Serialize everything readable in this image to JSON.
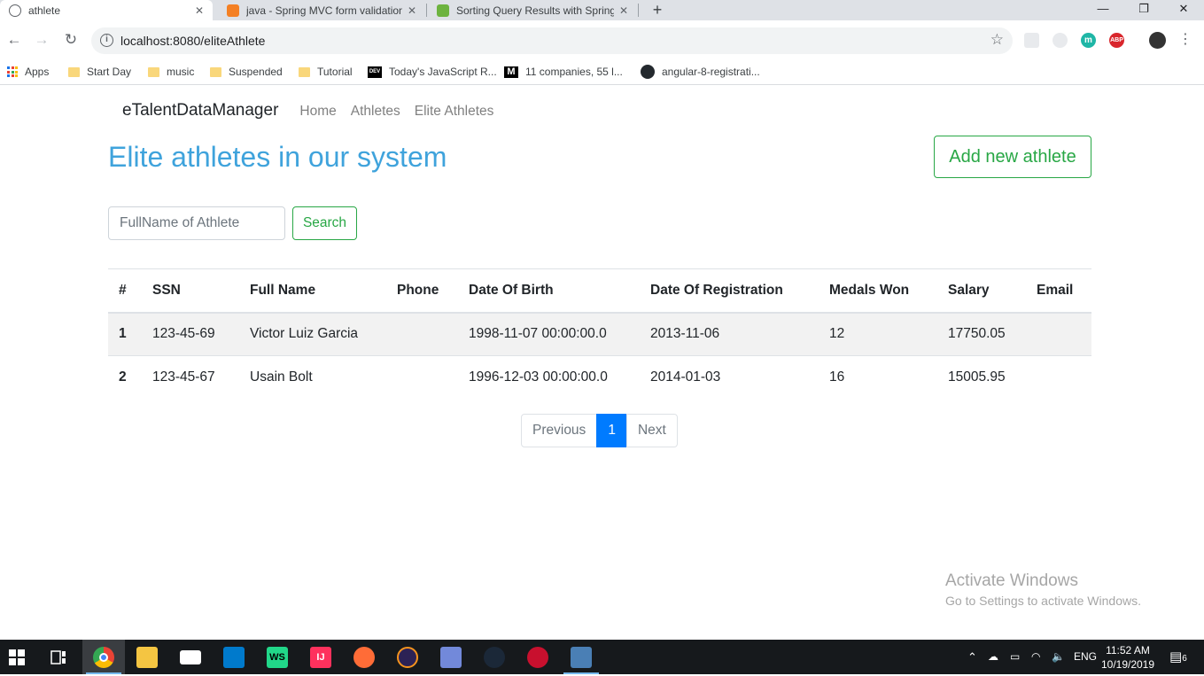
{
  "browser": {
    "tabs": [
      {
        "title": "athlete",
        "close": "✕"
      },
      {
        "title": "java - Spring MVC form validation",
        "close": "✕"
      },
      {
        "title": "Sorting Query Results with Spring",
        "close": "✕"
      }
    ],
    "new_tab": "+",
    "window_controls": {
      "minimize": "—",
      "maximize": "❐",
      "close": "✕"
    },
    "url": "localhost:8080/eliteAthlete",
    "bookmarks": [
      {
        "label": "Apps"
      },
      {
        "label": "Start Day"
      },
      {
        "label": "music"
      },
      {
        "label": "Suspended"
      },
      {
        "label": "Tutorial"
      },
      {
        "label": "Today's JavaScript R...",
        "icon_text": "DEV"
      },
      {
        "label": "11 companies, 55 l...",
        "icon_text": "M"
      },
      {
        "label": "angular-8-registrati..."
      }
    ],
    "extensions": {
      "m": "m",
      "abp": "ABP"
    }
  },
  "app": {
    "brand": "eTalentDataManager",
    "nav": [
      "Home",
      "Athletes",
      "Elite Athletes"
    ],
    "heading": "Elite athletes in our system",
    "add_button": "Add new athlete",
    "search": {
      "placeholder": "FullName of Athlete",
      "value": "",
      "button": "Search"
    },
    "table": {
      "columns": [
        "#",
        "SSN",
        "Full Name",
        "Phone",
        "Date Of Birth",
        "Date Of Registration",
        "Medals Won",
        "Salary",
        "Email"
      ],
      "rows": [
        {
          "num": "1",
          "ssn": "123-45-69",
          "name": "Victor Luiz Garcia",
          "phone": "",
          "dob": "1998-11-07 00:00:00.0",
          "reg": "2013-11-06",
          "medals": "12",
          "salary": "17750.05",
          "email": ""
        },
        {
          "num": "2",
          "ssn": "123-45-67",
          "name": "Usain Bolt",
          "phone": "",
          "dob": "1996-12-03 00:00:00.0",
          "reg": "2014-01-03",
          "medals": "16",
          "salary": "15005.95",
          "email": ""
        }
      ]
    },
    "pagination": {
      "previous": "Previous",
      "current": "1",
      "next": "Next"
    }
  },
  "watermark": {
    "line1": "Activate Windows",
    "line2": "Go to Settings to activate Windows."
  },
  "taskbar": {
    "ide_label": "IJ",
    "ws_label": "WS",
    "lang": "ENG",
    "time": "11:52 AM",
    "date": "10/19/2019",
    "notifications": "6"
  },
  "colors": {
    "accent": "#3fa3dc",
    "success": "#28a745",
    "primary": "#007bff"
  }
}
